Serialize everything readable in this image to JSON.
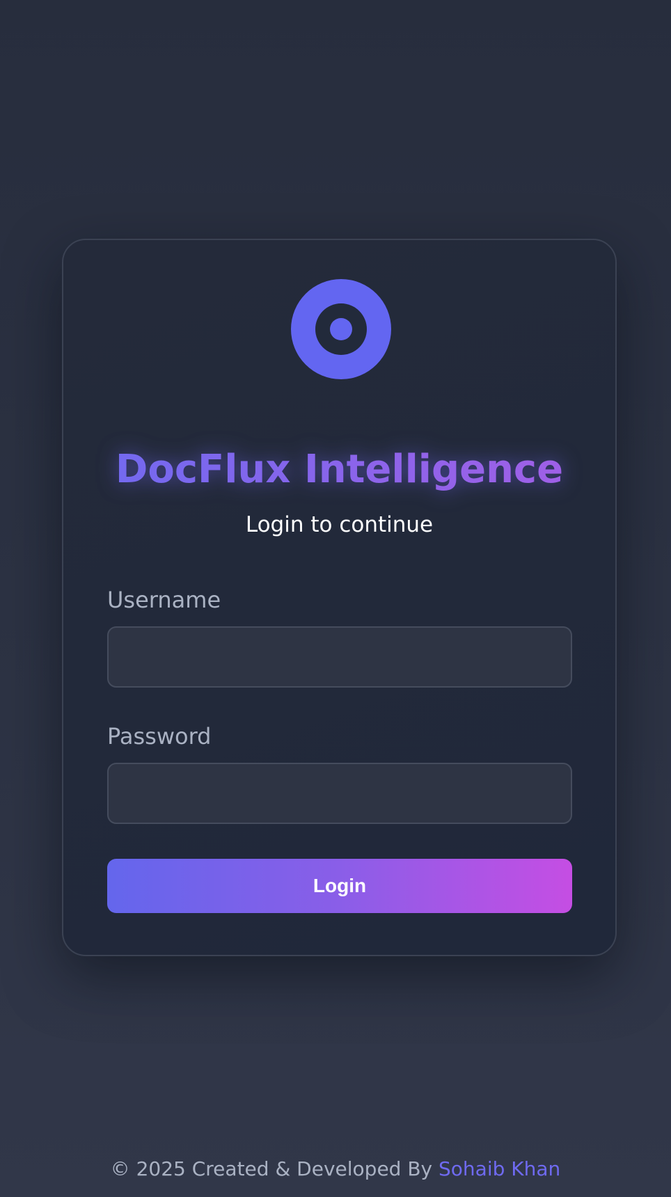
{
  "app": {
    "title": "DocFlux Intelligence",
    "subtitle": "Login to continue",
    "logo_icon": "target-icon",
    "accent_color": "#6366f1",
    "gradient_end_color": "#c74ee3"
  },
  "form": {
    "username_label": "Username",
    "username_value": "",
    "password_label": "Password",
    "password_value": "",
    "login_label": "Login"
  },
  "footer": {
    "text": "© 2025 Created & Developed By ",
    "author": "Sohaib Khan"
  }
}
